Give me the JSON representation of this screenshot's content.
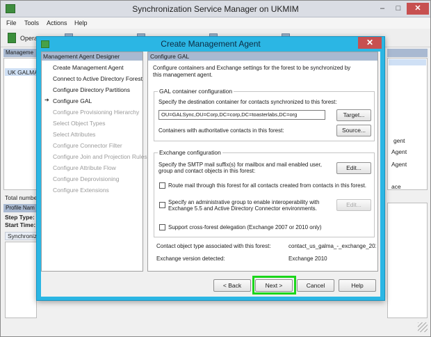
{
  "app": {
    "title": "Synchronization Service Manager on UKMIM",
    "menu": [
      "File",
      "Tools",
      "Actions",
      "Help"
    ],
    "toolbar_label": "Opera",
    "left_header": "Manageme",
    "left_selected": "UK GALMA",
    "total_label": "Total numbe",
    "profile_label": "Profile Nam",
    "step_type": "Step Type:",
    "start_time": "Start Time:",
    "sync_label": "Synchroniz",
    "right_fragments": [
      "gent",
      "Agent",
      "Agent",
      "ace"
    ]
  },
  "dialog": {
    "title": "Create Management Agent",
    "nav_header": "Management Agent Designer",
    "nav_items": [
      {
        "label": "Create Management Agent",
        "enabled": true
      },
      {
        "label": "Connect to Active Directory Forest",
        "enabled": true
      },
      {
        "label": "Configure Directory Partitions",
        "enabled": true
      },
      {
        "label": "Configure GAL",
        "enabled": true
      },
      {
        "label": "Configure Provisioning Hierarchy",
        "enabled": false
      },
      {
        "label": "Select Object Types",
        "enabled": false
      },
      {
        "label": "Select Attributes",
        "enabled": false
      },
      {
        "label": "Configure Connector Filter",
        "enabled": false
      },
      {
        "label": "Configure Join and Projection Rules",
        "enabled": false
      },
      {
        "label": "Configure Attribute Flow",
        "enabled": false
      },
      {
        "label": "Configure Deprovisioning",
        "enabled": false
      },
      {
        "label": "Configure Extensions",
        "enabled": false
      }
    ],
    "page_header": "Configure GAL",
    "intro_line1": "Configure containers and Exchange settings for the forest to be synchronized by",
    "intro_line2": "this management agent.",
    "gal_group": {
      "title": "GAL container configuration",
      "dest_label": "Specify the destination container for contacts synchronized to this forest:",
      "dest_value": "OU=GALSync,OU=Corp,DC=corp,DC=toasterlabs,DC=org",
      "target_button": "Target...",
      "source_label": "Containers with authoritative contacts in this forest:",
      "source_button": "Source..."
    },
    "exchange_group": {
      "title": "Exchange configuration",
      "smtp_line1": "Specify the SMTP mail suffix(s) for mailbox and mail enabled user,",
      "smtp_line2": "group and contact objects in this forest:",
      "edit_button": "Edit...",
      "route_label": "Route mail through this forest for all contacts created from contacts in this forest.",
      "admin_line1": "Specify an administrative group to enable interoperability with",
      "admin_line2": "Exchange 5.5 and Active Directory Connector environments.",
      "edit_button_2": "Edit...",
      "crossforest_label": "Support cross-forest delegation (Exchange 2007 or 2010 only)"
    },
    "contact_type_label": "Contact object type associated with this forest:",
    "contact_type_value": "contact_us_galma_-_exchange_201",
    "exchange_version_label": "Exchange version detected:",
    "exchange_version_value": "Exchange 2010",
    "buttons": {
      "back": "< Back",
      "next": "Next >",
      "cancel": "Cancel",
      "help": "Help"
    }
  }
}
